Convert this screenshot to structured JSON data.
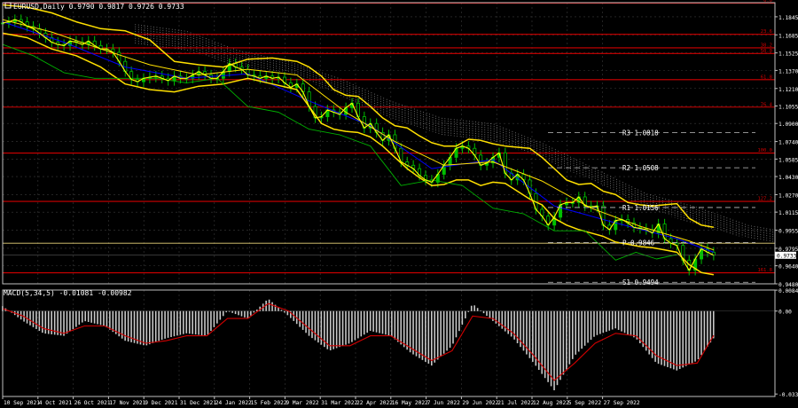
{
  "header": {
    "price_title": "EURUSD,Daily  0.9790 0.9817 0.9726 0.9733",
    "macd_title": "MACD(5,34,5) -0.01081 -0.00982"
  },
  "colors": {
    "background": "#000000",
    "axis": "#c0c0c0",
    "grid": "#3a3a3a",
    "candle": "#00c000",
    "price_line": "#ffff00",
    "bollinger": "#ffe000",
    "bollinger_mid": "#ffe000",
    "tenkan": "#0000ff",
    "chikou": "#00b000",
    "cloud": "#c0c0c0",
    "fib": "#d00000",
    "pivot": "#e8d37a",
    "macd_bar": "#c8c8c8",
    "macd_signal": "#d00000",
    "text": "#ffffff"
  },
  "chart_data": [
    {
      "type": "line",
      "name": "price-panel",
      "title": "EURUSD,Daily  0.9790 0.9817 0.9726 0.9733",
      "ylim": [
        0.948,
        1.197
      ],
      "y_ticks": [
        1.1845,
        1.1685,
        1.1525,
        1.137,
        1.121,
        1.1055,
        1.09,
        1.074,
        1.0585,
        1.043,
        1.027,
        1.0115,
        0.9955,
        0.9795,
        0.964,
        0.948
      ],
      "y_tick_labels": [
        "1.1845",
        "1.1685",
        "1.1525",
        "1.1370",
        "1.1210",
        "1.1055",
        "1.0900",
        "1.0740",
        "1.0585",
        "1.0430",
        "1.0270",
        "1.0115",
        "0.9955",
        "0.9795",
        "0.9640",
        "0.9480"
      ],
      "x_tick_labels": [
        "10 Sep 2021",
        "4 Oct 2021",
        "26 Oct 2021",
        "17 Nov 2021",
        "9 Dec 2021",
        "31 Dec 2021",
        "24 Jan 2022",
        "15 Feb 2022",
        "9 Mar 2022",
        "31 Mar 2022",
        "22 Apr 2022",
        "16 May 2022",
        "7 Jun 2022",
        "29 Jun 2022",
        "21 Jul 2022",
        "12 Aug 2022",
        "5 Sep 2022",
        "27 Sep 2022"
      ],
      "current_price": 0.9733,
      "current_price_label": "0.9733",
      "horizontal_levels": [
        {
          "kind": "fib",
          "value": 1.1965,
          "label": "0.0"
        },
        {
          "kind": "fib",
          "value": 1.169,
          "label": "23.6"
        },
        {
          "kind": "fib",
          "value": 1.157,
          "label": "38.2"
        },
        {
          "kind": "fib",
          "value": 1.152,
          "label": "50.0"
        },
        {
          "kind": "fib",
          "value": 1.1288,
          "label": "61.8"
        },
        {
          "kind": "fib",
          "value": 1.1045,
          "label": "76.4"
        },
        {
          "kind": "fib",
          "value": 1.0638,
          "label": "100.0"
        },
        {
          "kind": "fib",
          "value": 1.021,
          "label": "127.2"
        },
        {
          "kind": "fib",
          "value": 0.9578,
          "label": "161.8"
        },
        {
          "kind": "line",
          "value": 0.984,
          "label": ""
        }
      ],
      "pivots": [
        {
          "label": "R3  1.0818",
          "value": 1.0818
        },
        {
          "label": "R2  1.0508",
          "value": 1.0508
        },
        {
          "label": "R1  1.0156",
          "value": 1.0156
        },
        {
          "label": "P  0.9846",
          "value": 0.9846
        },
        {
          "label": "S1  0.9494",
          "value": 0.9494
        }
      ],
      "series": [
        {
          "name": "close",
          "x": [
            0,
            6,
            12,
            18,
            24,
            30,
            36,
            42,
            48,
            54,
            60,
            66,
            72,
            78,
            84,
            90,
            96,
            102,
            108,
            114,
            120,
            126,
            132,
            138,
            144,
            150,
            156,
            162,
            168,
            174,
            180,
            186,
            192,
            198,
            204,
            210,
            216,
            222,
            228,
            234,
            240,
            246,
            252,
            258,
            264,
            270,
            276,
            282,
            288,
            294,
            300,
            306,
            312,
            318,
            324,
            330,
            336,
            342,
            348,
            354,
            360,
            366,
            372,
            378,
            384,
            390,
            396,
            402,
            408,
            414,
            420,
            426,
            432,
            438,
            444,
            450,
            456,
            462,
            468,
            474,
            480,
            486,
            492,
            498,
            504,
            510,
            516,
            522,
            528,
            534,
            540,
            546,
            552,
            558,
            564,
            570,
            576,
            582,
            588,
            594,
            600,
            606,
            612,
            618,
            624,
            630,
            636,
            642,
            648,
            654,
            660,
            666,
            672,
            678,
            684,
            690,
            696
          ],
          "values": [
            1.179,
            1.18,
            1.182,
            1.18,
            1.176,
            1.174,
            1.17,
            1.166,
            1.162,
            1.16,
            1.159,
            1.163,
            1.162,
            1.16,
            1.163,
            1.159,
            1.156,
            1.156,
            1.153,
            1.145,
            1.136,
            1.129,
            1.127,
            1.13,
            1.131,
            1.132,
            1.13,
            1.128,
            1.132,
            1.13,
            1.13,
            1.133,
            1.136,
            1.133,
            1.13,
            1.13,
            1.136,
            1.143,
            1.14,
            1.138,
            1.133,
            1.132,
            1.13,
            1.132,
            1.13,
            1.131,
            1.126,
            1.122,
            1.125,
            1.118,
            1.105,
            1.095,
            1.096,
            1.102,
            1.1,
            1.098,
            1.104,
            1.108,
            1.096,
            1.086,
            1.09,
            1.082,
            1.075,
            1.08,
            1.068,
            1.056,
            1.053,
            1.05,
            1.044,
            1.04,
            1.038,
            1.045,
            1.053,
            1.06,
            1.068,
            1.07,
            1.068,
            1.062,
            1.053,
            1.055,
            1.06,
            1.064,
            1.046,
            1.04,
            1.045,
            1.04,
            1.028,
            1.014,
            1.008,
            1.0,
            1.007,
            1.018,
            1.02,
            1.02,
            1.025,
            1.017,
            1.016,
            1.017,
            1.0,
            0.996,
            1.004,
            1.005,
            1.002,
            0.998,
            0.997,
            0.996,
            0.993,
            1.001,
            0.988,
            0.984,
            0.982,
            0.969,
            0.96,
            0.97,
            0.979,
            0.976,
            0.9733
          ]
        },
        {
          "name": "upper-band",
          "x": [
            0,
            24,
            48,
            72,
            96,
            120,
            144,
            168,
            192,
            216,
            240,
            264,
            288,
            300,
            312,
            324,
            336,
            348,
            360,
            372,
            384,
            396,
            408,
            420,
            432,
            444,
            456,
            468,
            480,
            492,
            504,
            516,
            528,
            540,
            552,
            564,
            576,
            588,
            600,
            612,
            624,
            636,
            648,
            660,
            672,
            684,
            696
          ],
          "values": [
            1.195,
            1.193,
            1.188,
            1.18,
            1.174,
            1.172,
            1.164,
            1.145,
            1.142,
            1.14,
            1.147,
            1.148,
            1.145,
            1.14,
            1.132,
            1.12,
            1.115,
            1.114,
            1.105,
            1.095,
            1.088,
            1.086,
            1.079,
            1.073,
            1.07,
            1.07,
            1.076,
            1.075,
            1.072,
            1.07,
            1.069,
            1.068,
            1.06,
            1.05,
            1.04,
            1.036,
            1.037,
            1.03,
            1.027,
            1.02,
            1.018,
            1.017,
            1.018,
            1.019,
            1.006,
            1.0,
            0.998
          ]
        },
        {
          "name": "lower-band",
          "x": [
            0,
            24,
            48,
            72,
            96,
            120,
            144,
            168,
            192,
            216,
            240,
            264,
            288,
            300,
            312,
            324,
            336,
            348,
            360,
            372,
            384,
            396,
            408,
            420,
            432,
            444,
            456,
            468,
            480,
            492,
            504,
            516,
            528,
            540,
            552,
            564,
            576,
            588,
            600,
            612,
            624,
            636,
            648,
            660,
            672,
            684,
            696
          ],
          "values": [
            1.17,
            1.166,
            1.156,
            1.15,
            1.14,
            1.125,
            1.12,
            1.118,
            1.123,
            1.125,
            1.13,
            1.125,
            1.12,
            1.105,
            1.09,
            1.085,
            1.083,
            1.082,
            1.078,
            1.07,
            1.06,
            1.05,
            1.042,
            1.035,
            1.036,
            1.04,
            1.04,
            1.035,
            1.038,
            1.037,
            1.03,
            1.023,
            1.018,
            1.006,
            1.0,
            0.996,
            0.993,
            0.99,
            0.985,
            0.983,
            0.981,
            0.98,
            0.978,
            0.976,
            0.965,
            0.958,
            0.956
          ]
        },
        {
          "name": "middle-band",
          "x": [
            0,
            48,
            96,
            144,
            192,
            240,
            288,
            336,
            384,
            432,
            480,
            528,
            576,
            624,
            672,
            696
          ],
          "values": [
            1.182,
            1.171,
            1.156,
            1.142,
            1.133,
            1.138,
            1.133,
            1.1,
            1.074,
            1.053,
            1.056,
            1.039,
            1.015,
            0.999,
            0.986,
            0.978
          ]
        },
        {
          "name": "tenkan",
          "x": [
            0,
            60,
            120,
            180,
            240,
            300,
            360,
            420,
            480,
            540,
            600,
            660,
            696
          ],
          "values": [
            1.18,
            1.162,
            1.14,
            1.13,
            1.134,
            1.11,
            1.088,
            1.05,
            1.058,
            1.017,
            1.002,
            0.988,
            0.976
          ]
        },
        {
          "name": "chikou",
          "x": [
            0,
            30,
            60,
            90,
            120,
            150,
            180,
            210,
            240,
            270,
            300,
            330,
            360,
            390,
            420,
            450,
            480,
            510,
            540,
            570,
            600,
            620,
            640,
            660
          ],
          "values": [
            1.16,
            1.15,
            1.135,
            1.13,
            1.13,
            1.13,
            1.126,
            1.13,
            1.105,
            1.1,
            1.085,
            1.08,
            1.07,
            1.035,
            1.04,
            1.035,
            1.015,
            1.01,
            0.995,
            0.995,
            0.969,
            0.976,
            0.97,
            0.974
          ]
        },
        {
          "name": "cloud-top",
          "x": [
            130,
            180,
            230,
            280,
            330,
            380,
            430,
            480,
            530,
            580,
            630,
            680,
            730,
            756
          ],
          "values": [
            1.178,
            1.172,
            1.155,
            1.145,
            1.13,
            1.11,
            1.095,
            1.09,
            1.072,
            1.05,
            1.028,
            1.016,
            1.0,
            0.996
          ]
        },
        {
          "name": "cloud-bottom",
          "x": [
            130,
            180,
            230,
            280,
            330,
            380,
            430,
            480,
            530,
            580,
            630,
            680,
            730,
            756
          ],
          "values": [
            1.16,
            1.155,
            1.14,
            1.135,
            1.115,
            1.095,
            1.08,
            1.075,
            1.058,
            1.038,
            1.015,
            1.0,
            0.988,
            0.984
          ]
        }
      ]
    },
    {
      "type": "bar",
      "name": "macd-panel",
      "title": "MACD(5,34,5) -0.01081 -0.00982",
      "ylim": [
        -0.0345,
        0.0085
      ],
      "y_ticks": [
        0.00846,
        0.0,
        -0.0335
      ],
      "y_tick_labels": [
        "0.00846",
        "0.00",
        "-0.0335"
      ],
      "series": [
        {
          "name": "macd-histogram",
          "x": [
            0,
            20,
            40,
            60,
            80,
            100,
            120,
            140,
            160,
            180,
            200,
            220,
            240,
            260,
            280,
            300,
            320,
            340,
            360,
            380,
            400,
            420,
            440,
            460,
            480,
            500,
            520,
            540,
            560,
            580,
            600,
            620,
            640,
            660,
            680,
            696
          ],
          "values": [
            0.002,
            -0.004,
            -0.009,
            -0.01,
            -0.004,
            -0.006,
            -0.012,
            -0.014,
            -0.011,
            -0.009,
            -0.01,
            0.0,
            -0.003,
            0.005,
            -0.002,
            -0.01,
            -0.016,
            -0.013,
            -0.008,
            -0.01,
            -0.017,
            -0.022,
            -0.014,
            0.003,
            -0.004,
            -0.011,
            -0.021,
            -0.032,
            -0.018,
            -0.01,
            -0.007,
            -0.011,
            -0.021,
            -0.024,
            -0.02,
            -0.011
          ]
        },
        {
          "name": "macd-signal",
          "x": [
            0,
            20,
            40,
            60,
            80,
            100,
            120,
            140,
            160,
            180,
            200,
            220,
            240,
            260,
            280,
            300,
            320,
            340,
            360,
            380,
            400,
            420,
            440,
            460,
            480,
            500,
            520,
            540,
            560,
            580,
            600,
            620,
            640,
            660,
            680,
            696
          ],
          "values": [
            0.001,
            -0.002,
            -0.007,
            -0.009,
            -0.006,
            -0.006,
            -0.01,
            -0.013,
            -0.012,
            -0.01,
            -0.01,
            -0.003,
            -0.003,
            0.003,
            0.0,
            -0.007,
            -0.014,
            -0.014,
            -0.01,
            -0.01,
            -0.015,
            -0.02,
            -0.016,
            -0.002,
            -0.003,
            -0.009,
            -0.018,
            -0.028,
            -0.021,
            -0.013,
            -0.009,
            -0.01,
            -0.018,
            -0.022,
            -0.021,
            -0.0098
          ]
        }
      ]
    }
  ]
}
